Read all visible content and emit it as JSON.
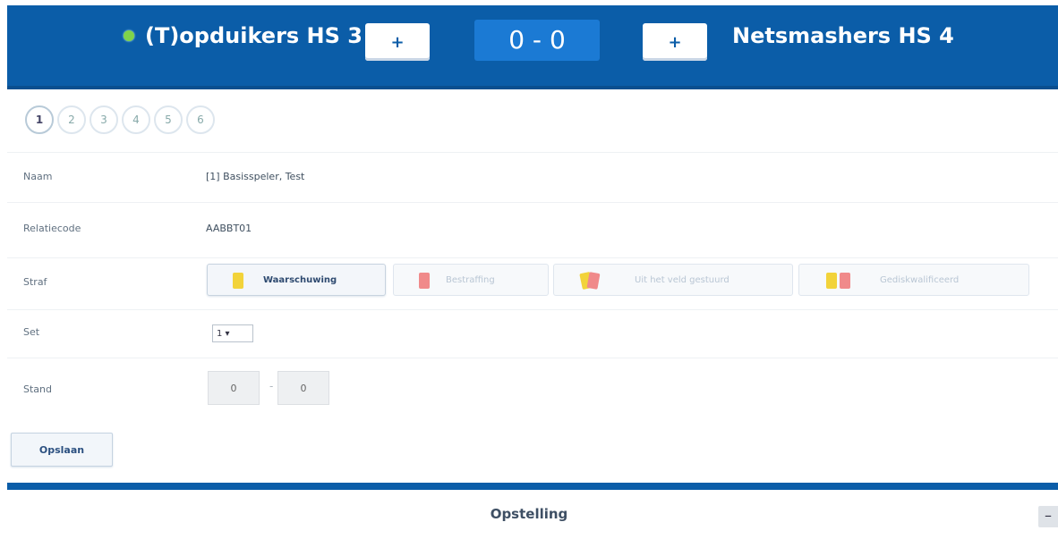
{
  "match": {
    "home_team": "(T)opduikers HS 3",
    "away_team": "Netsmashers HS 4",
    "score": "0 - 0",
    "add_home_label": "+",
    "add_away_label": "+"
  },
  "steps": [
    "1",
    "2",
    "3",
    "4",
    "5",
    "6"
  ],
  "form": {
    "name_label": "Naam",
    "name_value": "[1]  Basisspeler, Test",
    "relation_label": "Relatiecode",
    "relation_value": "AABBT01",
    "penalty_label": "Straf",
    "penalties": [
      "Waarschuwing",
      "Bestraffing",
      "Uit het veld gestuurd",
      "Gediskwalificeerd"
    ],
    "set_label": "Set",
    "set_value": "1 ▾",
    "score_label": "Stand",
    "score_home": "0",
    "score_separator": "-",
    "score_away": "0",
    "save_label": "Opslaan"
  },
  "section": {
    "title": "Opstelling",
    "collapse_label": "–"
  },
  "colors": {
    "header_blue": "#0b5da8",
    "score_blue": "#1b7ad4",
    "yellow_card": "#f2d33a",
    "red_card": "#f08a8a"
  }
}
